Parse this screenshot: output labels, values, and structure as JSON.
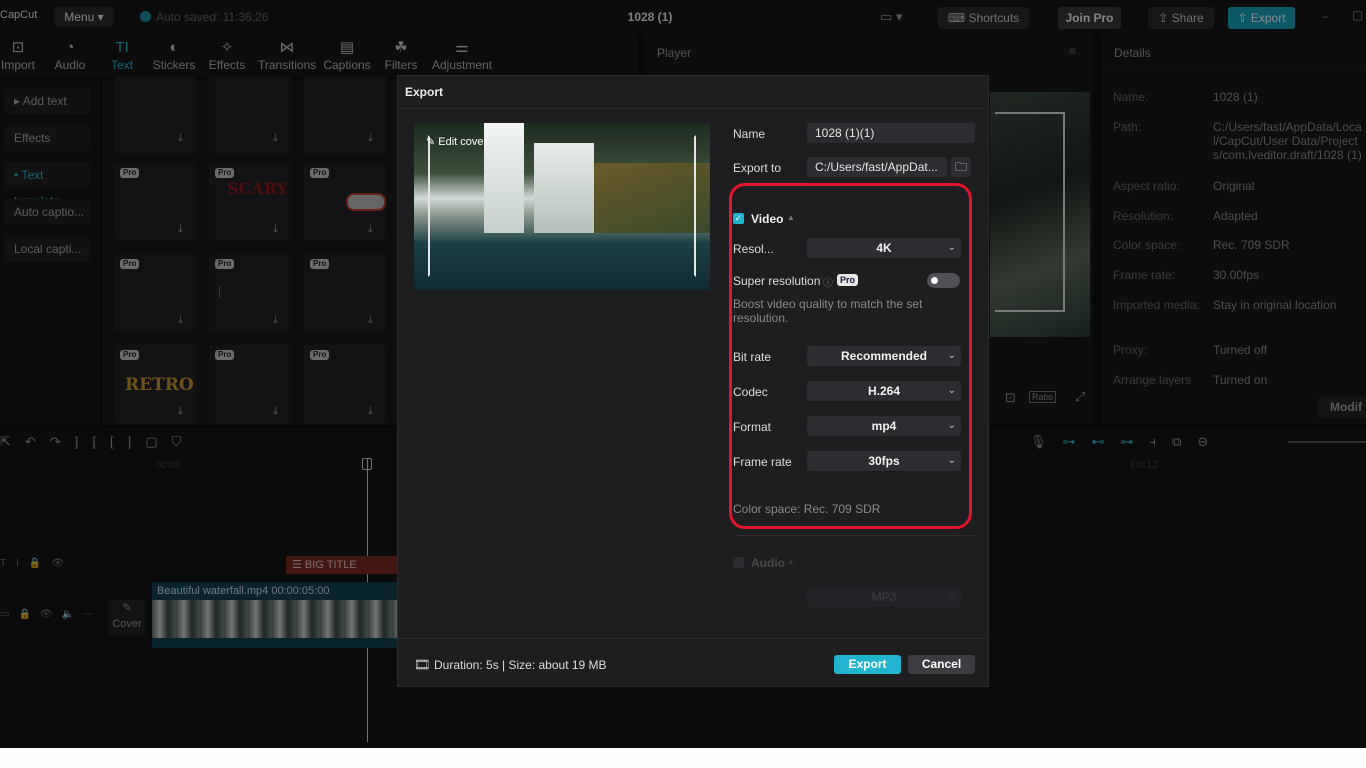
{
  "topbar": {
    "logo": "CapCut",
    "menu": "Menu",
    "autosave": "Auto saved: 11:36:26",
    "project_title": "1028 (1)",
    "shortcuts": "Shortcuts",
    "join_pro": "Join Pro",
    "share": "Share",
    "export": "Export"
  },
  "tools": [
    {
      "label": "Import"
    },
    {
      "label": "Audio"
    },
    {
      "label": "Text"
    },
    {
      "label": "Stickers"
    },
    {
      "label": "Effects"
    },
    {
      "label": "Transitions"
    },
    {
      "label": "Captions"
    },
    {
      "label": "Filters"
    },
    {
      "label": "Adjustment"
    }
  ],
  "leftnav": [
    "Add text",
    "Effects",
    "Text template",
    "Auto captio...",
    "Local capti..."
  ],
  "grid": {
    "pro_label": "Pro",
    "sample_texts": [
      "SCARY",
      "RETRO"
    ]
  },
  "player": {
    "title": "Player",
    "ratio": "Ratio"
  },
  "details": {
    "title": "Details",
    "rows": [
      {
        "label": "Name:",
        "value": "1028 (1)"
      },
      {
        "label": "Path:",
        "value": "C:/Users/fast/AppData/Local/CapCut/User Data/Projects/com.lveditor.draft/1028 (1)"
      },
      {
        "label": "Aspect ratio:",
        "value": "Original"
      },
      {
        "label": "Resolution:",
        "value": "Adapted"
      },
      {
        "label": "Color space:",
        "value": "Rec. 709 SDR"
      },
      {
        "label": "Frame rate:",
        "value": "30.00fps"
      },
      {
        "label": "Imported media:",
        "value": "Stay in original location"
      },
      {
        "label": "Proxy:",
        "value": "Turned off"
      },
      {
        "label": "Arrange layers",
        "value": "Turned on"
      }
    ],
    "modify": "Modif"
  },
  "timeline": {
    "time_start": "00:00",
    "time_mark": "|00:12",
    "title_clip": "BIG TITLE",
    "video_clip": "Beautiful waterfall.mp4  00:00:05:00",
    "cover": "Cover"
  },
  "dialog": {
    "title": "Export",
    "edit_cover": "Edit cover",
    "name_label": "Name",
    "name_value": "1028 (1)(1)",
    "export_to_label": "Export to",
    "export_to_value": "C:/Users/fast/AppDat...",
    "video_section": "Video",
    "resolution_label": "Resol...",
    "resolution_value": "4K",
    "super_resolution_label": "Super resolution",
    "pro_badge": "Pro",
    "super_resolution_desc": "Boost video quality to match the set resolution.",
    "bitrate_label": "Bit rate",
    "bitrate_value": "Recommended",
    "codec_label": "Codec",
    "codec_value": "H.264",
    "format_label": "Format",
    "format_value": "mp4",
    "framerate_label": "Frame rate",
    "framerate_value": "30fps",
    "color_space": "Color space: Rec. 709 SDR",
    "audio_section": "Audio",
    "audio_format_value": "MP3",
    "footer_info": "Duration: 5s | Size: about 19 MB",
    "export_button": "Export",
    "cancel_button": "Cancel"
  },
  "colors": {
    "accent": "#22b3cf",
    "highlight": "#e0162c"
  }
}
